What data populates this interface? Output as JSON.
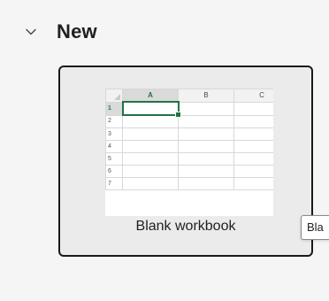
{
  "section": {
    "title": "New",
    "chevron_icon": "chevron-down-icon"
  },
  "template": {
    "label": "Blank workbook",
    "thumbnail": {
      "columns": [
        "A",
        "B",
        "C"
      ],
      "rows": [
        "1",
        "2",
        "3",
        "4",
        "5",
        "6",
        "7"
      ],
      "active_column": "A",
      "active_row": "1",
      "accent_color": "#217346"
    }
  },
  "tooltip": {
    "text": "Bla"
  }
}
